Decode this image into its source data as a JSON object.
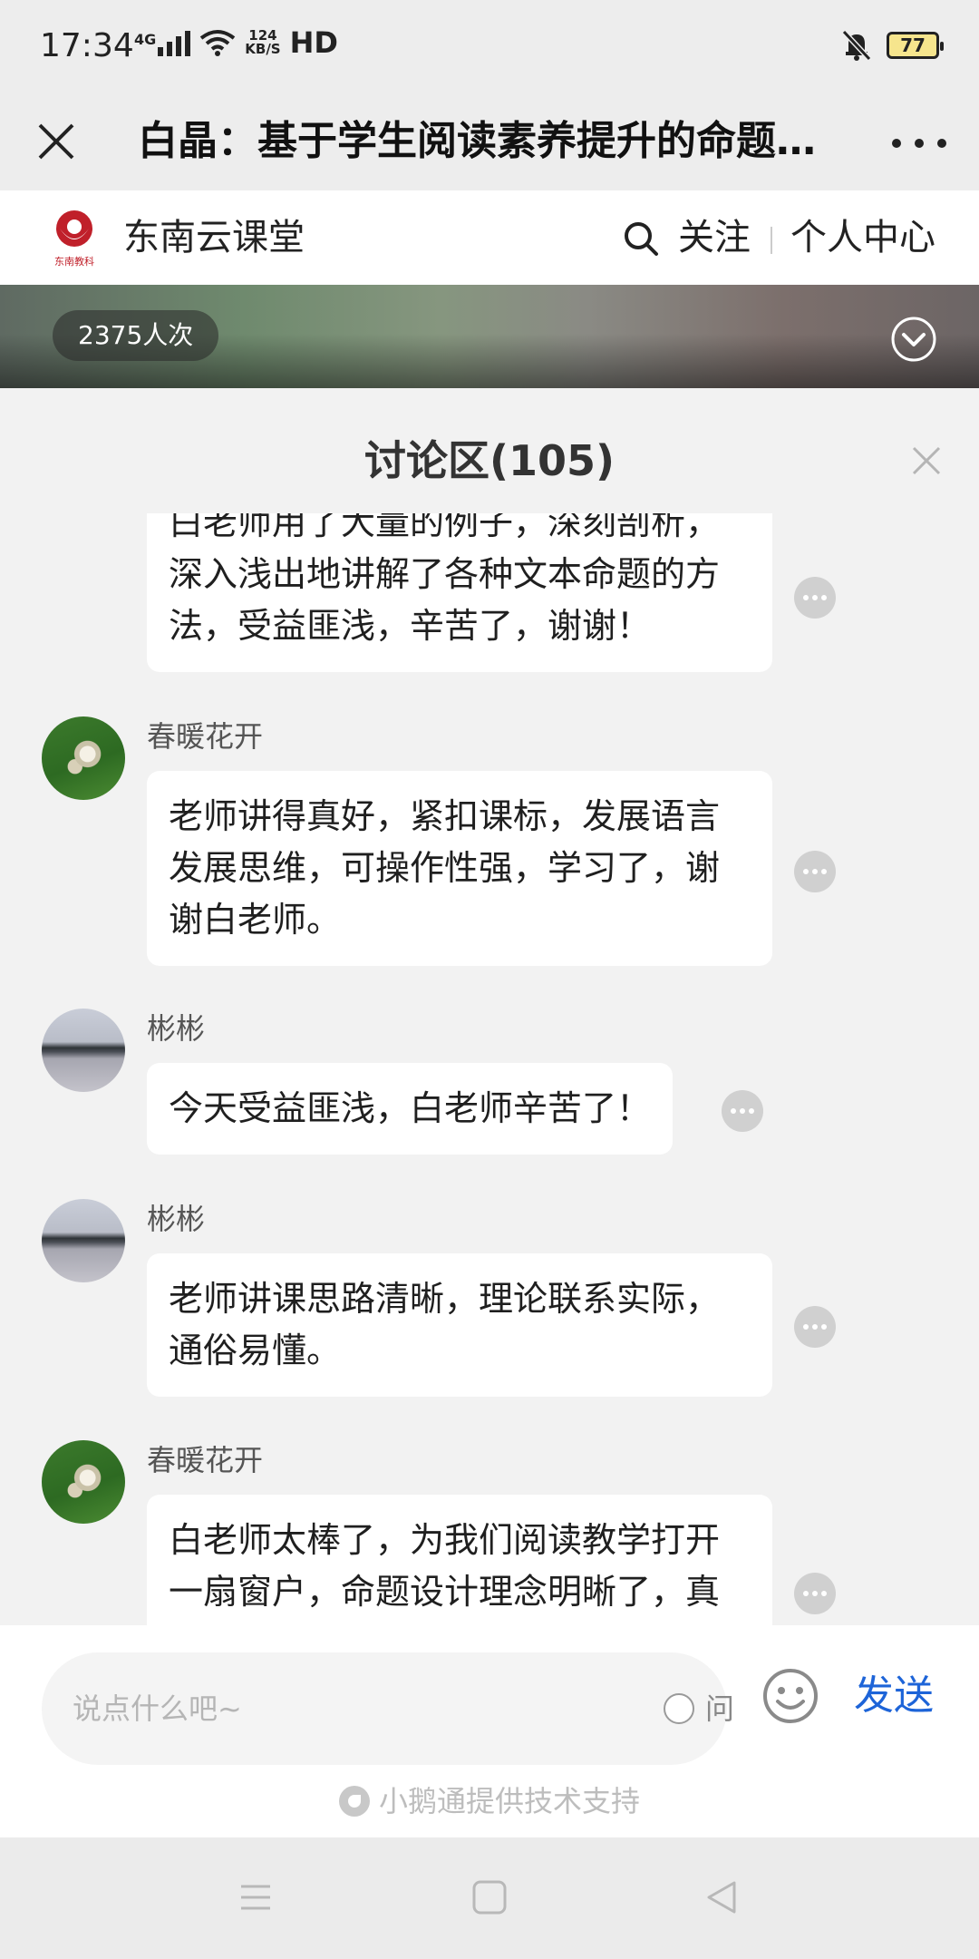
{
  "status_bar": {
    "time": "17:34",
    "network": "4G",
    "speed_value": "124",
    "speed_unit": "KB/S",
    "hd": "HD",
    "battery": "77"
  },
  "header": {
    "title": "白晶：基于学生阅读素养提升的命题…"
  },
  "channel": {
    "name": "东南云课堂",
    "logo_text": "东南教科",
    "follow_label": "关注",
    "personal_label": "个人中心"
  },
  "video": {
    "views": "2375人次"
  },
  "discussion": {
    "title": "讨论区(105)",
    "messages": [
      {
        "user": "",
        "text": "白老师用了大量的例子，深刻剖析，深入浅出地讲解了各种文本命题的方法，受益匪浅，辛苦了，谢谢！"
      },
      {
        "user": "春暖花开",
        "text": "老师讲得真好，紧扣课标，发展语言发展思维，可操作性强，学习了，谢谢白老师。"
      },
      {
        "user": "彬彬",
        "text": "今天受益匪浅，白老师辛苦了！"
      },
      {
        "user": "彬彬",
        "text": "老师讲课思路清晰，理论联系实际，通俗易懂。"
      },
      {
        "user": "春暖花开",
        "text": "白老师太棒了，为我们阅读教学打开一扇窗户，命题设计理念明晰了，真"
      }
    ]
  },
  "composer": {
    "placeholder": "说点什么吧~",
    "ask_label": "问",
    "send_label": "发送",
    "tech_support": "小鹅通提供技术支持"
  },
  "colors": {
    "accent": "#1d64d8",
    "panel_bg": "#f2f2f2",
    "bubble_bg": "#ffffff"
  }
}
